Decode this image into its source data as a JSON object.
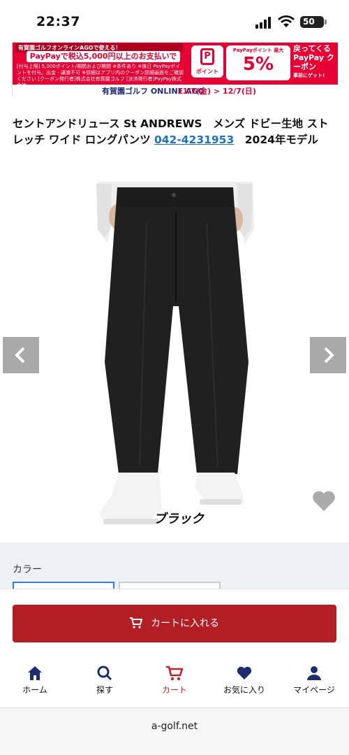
{
  "status_bar": {
    "time": "22:37",
    "battery": "50",
    "battery_level": 0.5
  },
  "banner": {
    "top_text": "有賀園ゴルフオンラインAGOで使える！",
    "promo": "PayPayで税込5,000円以上のお支払いで",
    "fine_print": "[付与上限] 5,000ポイント/期間および期間 ※条件あり ※後日 PayPayポイントを付与。出金・譲渡不可 ※詳細はアプリ内のクーポン詳細画面をご確認ください [クーポン発行者]株式会社有賀園ゴルフ [決済発行者]PayPay株式会社",
    "point_label": "ポイント",
    "max_text": "PayPayポイント 最大",
    "percent": "5%",
    "right_text": "戻ってくる PayPay クーポン",
    "right_small": "事前にゲット!",
    "ago": "有賀園ゴルフ ONLINE AGO",
    "dates": "11/7(金) > 12/7(日)"
  },
  "product": {
    "title_part1": "セントアンドリュース St ANDREWS　メンズ ドビー生地 ストレッチ ワイド ロングパンツ ",
    "phone": "042-4231953",
    "title_part2": "　2024年モデル",
    "image_caption": "ブラック"
  },
  "color_section": {
    "label": "カラー"
  },
  "cart": {
    "button_label": "カートに入れる"
  },
  "nav": {
    "items": [
      {
        "label": "ホーム",
        "icon": "home-icon"
      },
      {
        "label": "探す",
        "icon": "search-icon"
      },
      {
        "label": "カート",
        "icon": "cart-icon"
      },
      {
        "label": "お気に入り",
        "icon": "heart-icon"
      },
      {
        "label": "マイページ",
        "icon": "person-icon"
      }
    ],
    "active_color": "#c0242a"
  },
  "browser": {
    "url": "a-golf.net"
  },
  "colors": {
    "cart_button": "#b21e23",
    "link": "#1a73c9",
    "banner_red": "#e60033"
  }
}
